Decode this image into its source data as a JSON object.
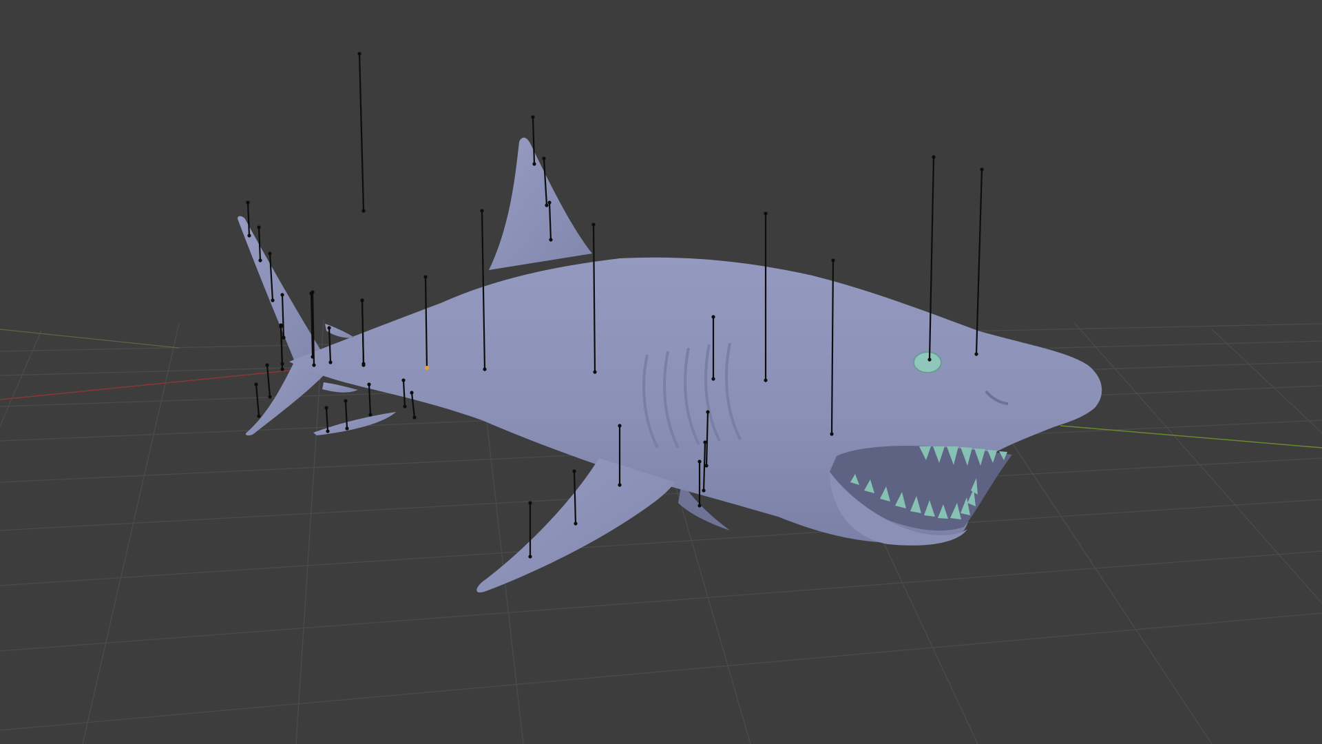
{
  "viewport": {
    "background": "#3d3d3d",
    "grid_color": "#4a4a4a",
    "axis_x_color": "#9a3a3a",
    "axis_y_color": "#6b8a2e"
  },
  "model": {
    "body_color": "#8d93b8",
    "teeth_color": "#86c1b4",
    "eye_color": "#8fc7bd",
    "mouth_color": "#5a5e7c"
  },
  "rig": {
    "line_color": "#0d0d0d",
    "active_color": "#e8a030"
  }
}
